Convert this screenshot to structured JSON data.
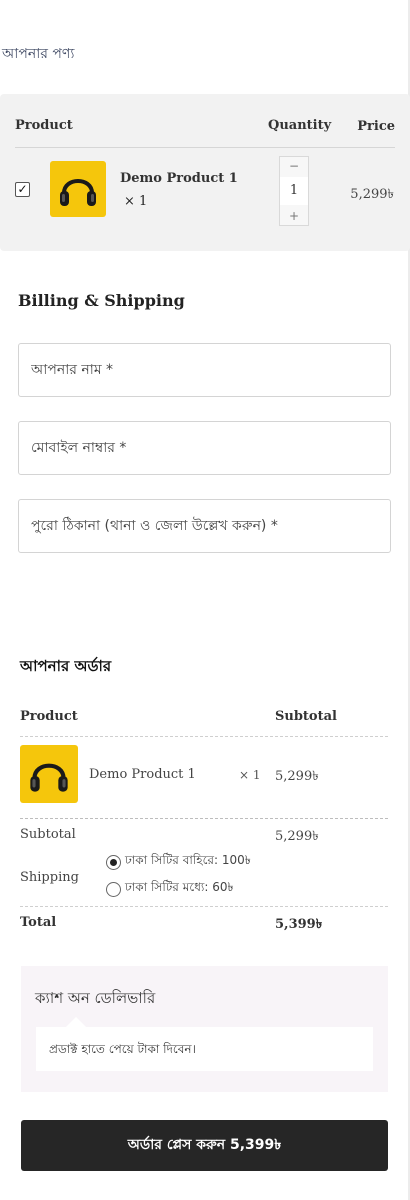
{
  "cart": {
    "section_title": "আপনার পণ্য",
    "headers": {
      "product": "Product",
      "quantity": "Quantity",
      "price": "Price"
    },
    "item": {
      "checked": true,
      "checkmark": "✓",
      "name": "Demo Product 1",
      "qty_label": "× 1",
      "quantity": "1",
      "minus": "−",
      "plus": "+",
      "price": "5,299৳",
      "image_icon": "headphones-icon"
    }
  },
  "billing": {
    "title": "Billing & Shipping",
    "name_placeholder": "আপনার নাম *",
    "mobile_placeholder": "মোবাইল নাম্বার *",
    "address_placeholder": "পুরো ঠিকানা (থানা ও জেলা উল্লেখ করুন) *"
  },
  "order": {
    "title": "আপনার অর্ডার",
    "headers": {
      "product": "Product",
      "subtotal": "Subtotal"
    },
    "item": {
      "name": "Demo Product 1",
      "qty": "× 1",
      "subtotal": "5,299৳"
    },
    "subtotal_label": "Subtotal",
    "subtotal_value": "5,299৳",
    "shipping_label": "Shipping",
    "shipping_options": [
      {
        "label": "ঢাকা সিটির বাহিরে: 100৳",
        "selected": true
      },
      {
        "label": "ঢাকা সিটির মধ্যে: 60৳",
        "selected": false
      }
    ],
    "total_label": "Total",
    "total_value": "5,399৳"
  },
  "payment": {
    "method_title": "ক্যাশ অন ডেলিভারি",
    "description": "প্রডাক্ট হাতে পেয়ে টাকা দিবেন।"
  },
  "place_order": {
    "label": "অর্ডার প্লেস করুন  5,399৳"
  },
  "colors": {
    "accent": "#262626",
    "product_image_bg": "#f5c60c",
    "cart_bg": "#f2f2f2",
    "payment_bg": "#f8f4f8"
  }
}
